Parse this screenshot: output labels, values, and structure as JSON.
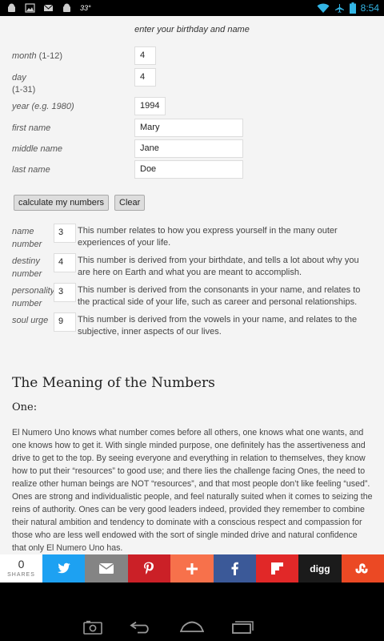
{
  "status_bar": {
    "temperature": "33°",
    "time": "8:54",
    "left_icons": [
      "android-icon",
      "image-icon",
      "mail-icon",
      "android-icon"
    ],
    "right_icons": [
      "wifi-icon",
      "airplane-icon",
      "battery-icon"
    ]
  },
  "form": {
    "heading": "enter your birthday and name",
    "month_label": "month",
    "month_hint": "(1-12)",
    "month_value": "4",
    "day_label": "day",
    "day_hint": "(1-31)",
    "day_value": "4",
    "year_label": "year (e.g. 1980)",
    "year_value": "1994",
    "first_name_label": "first name",
    "first_name_value": "Mary",
    "middle_name_label": "middle name",
    "middle_name_value": "Jane",
    "last_name_label": "last name",
    "last_name_value": "Doe",
    "calculate_label": "calculate my numbers",
    "clear_label": "Clear"
  },
  "results": [
    {
      "label_line1": "name",
      "label_line2": "number",
      "value": "3",
      "description": "This number relates to how you express yourself in the many outer experiences of your life."
    },
    {
      "label_line1": "destiny",
      "label_line2": "number",
      "value": "4",
      "description": "This number is derived from your birthdate, and tells a lot about why you are here on Earth and what you are meant to accomplish."
    },
    {
      "label_line1": "personality",
      "label_line2": "number",
      "value": "3",
      "description": "This number is derived from the consonants in your name, and relates to the practical side of your life, such as career and personal relationships."
    },
    {
      "label_line1": "soul urge",
      "label_line2": "",
      "value": "9",
      "description": "This number is derived from the vowels in your name, and relates to the subjective, inner aspects of our lives."
    }
  ],
  "article": {
    "title": "The Meaning of the Numbers",
    "section_title": "One:",
    "paragraph": "El Numero Uno knows what number comes before all others, one knows what one wants, and one knows how to get it. With single minded purpose, one definitely has the assertiveness and drive to get to the top. By seeing everyone and everything in relation to themselves, they know how to put their “resources” to good use; and there lies the challenge facing Ones, the need to realize other human beings are NOT “resources”, and that most people don’t like feeling “used”. Ones are strong and individualistic people, and feel naturally suited when it comes to seizing the reins of authority. Ones can be very good leaders indeed, provided they remember to combine their natural ambition and tendency to dominate with a conscious respect and compassion for those who are less well endowed with the sort of single minded drive and natural confidence that only El Numero Uno has."
  },
  "share_bar": {
    "count": "0",
    "count_label": "SHARES",
    "buttons": [
      {
        "name": "twitter",
        "color": "#1da1f2",
        "icon": "twitter-icon"
      },
      {
        "name": "email",
        "color": "#848484",
        "icon": "mail-icon"
      },
      {
        "name": "pinterest",
        "color": "#cb2027",
        "icon": "pinterest-icon"
      },
      {
        "name": "more",
        "color": "#f7714b",
        "icon": "plus-icon"
      },
      {
        "name": "facebook",
        "color": "#3b5998",
        "icon": "facebook-icon"
      },
      {
        "name": "flipboard",
        "color": "#e12828",
        "icon": "flipboard-icon"
      },
      {
        "name": "digg",
        "color": "#1b1b1b",
        "icon": "digg-icon",
        "text": "digg"
      },
      {
        "name": "stumbleupon",
        "color": "#eb4924",
        "icon": "stumbleupon-icon"
      }
    ]
  },
  "nav_bar": {
    "icons": [
      "screenshot-icon",
      "back-icon",
      "home-icon",
      "recent-apps-icon"
    ]
  }
}
